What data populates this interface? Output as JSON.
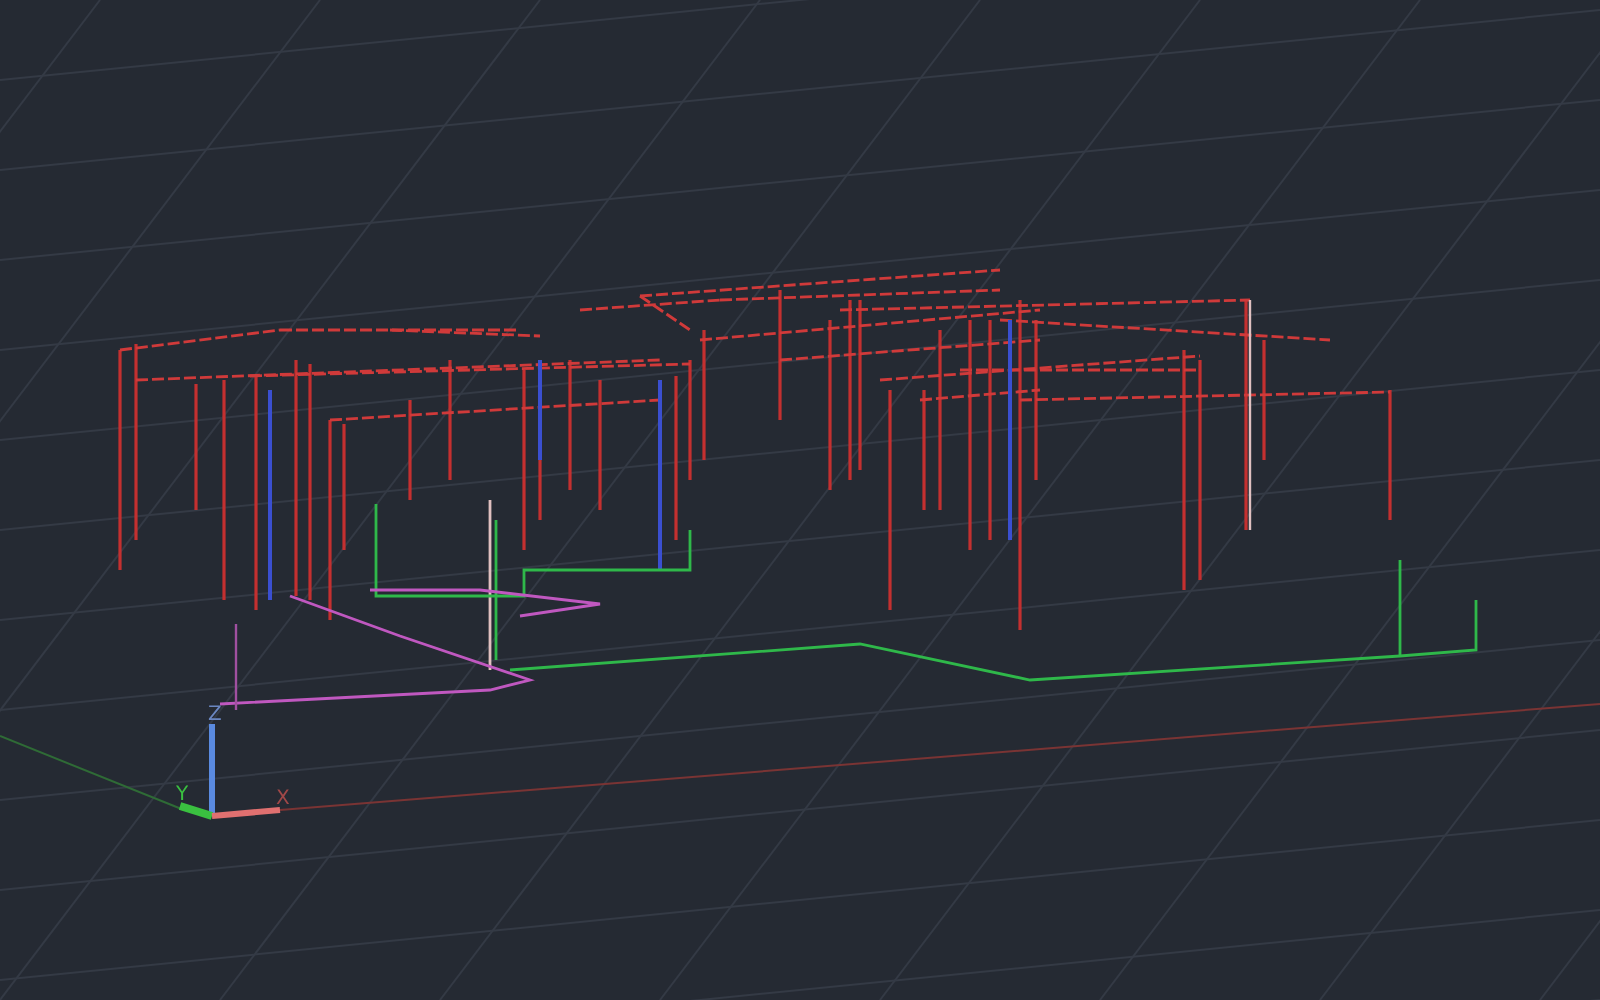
{
  "viewport": {
    "ucs_icon": {
      "z_label": "Z",
      "y_label": "Y",
      "x_label": "X"
    }
  }
}
